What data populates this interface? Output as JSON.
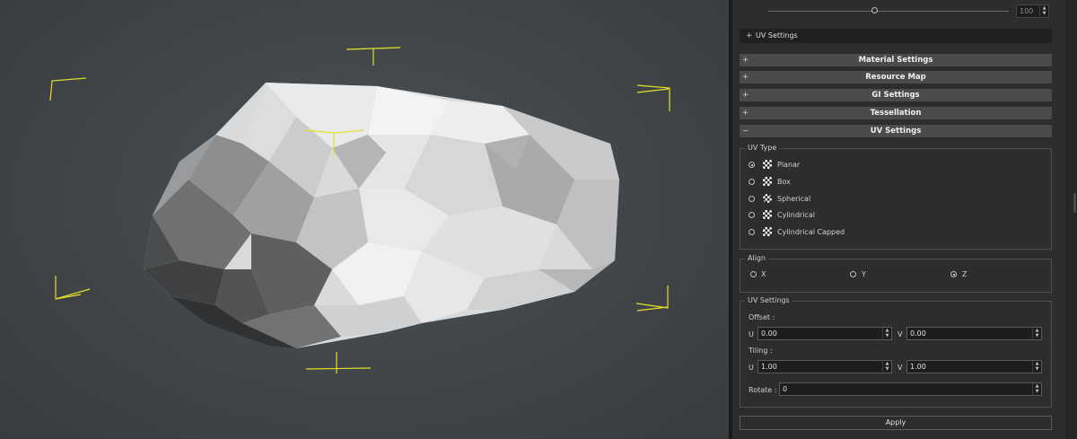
{
  "top_slider": {
    "value": "100"
  },
  "collapsed_header": {
    "sign": "+",
    "label": "UV Settings"
  },
  "sections": [
    {
      "sign": "+",
      "label": "Material Settings"
    },
    {
      "sign": "+",
      "label": "Resource Map"
    },
    {
      "sign": "+",
      "label": "GI Settings"
    },
    {
      "sign": "+",
      "label": "Tessellation"
    },
    {
      "sign": "−",
      "label": "UV Settings"
    }
  ],
  "uv_type": {
    "title": "UV Type",
    "selected": "Planar",
    "options": [
      {
        "label": "Planar"
      },
      {
        "label": "Box"
      },
      {
        "label": "Spherical"
      },
      {
        "label": "Cylindrical"
      },
      {
        "label": "Cylindrical Capped"
      }
    ]
  },
  "align": {
    "title": "Align",
    "selected": "Z",
    "options": [
      {
        "label": "X"
      },
      {
        "label": "Y"
      },
      {
        "label": "Z"
      }
    ]
  },
  "uv_settings": {
    "title": "UV Settings",
    "offset_label": "Offset :",
    "tiling_label": "Tiling :",
    "u_label": "U",
    "v_label": "V",
    "offset_u": "0.00",
    "offset_v": "0.00",
    "tiling_u": "1.00",
    "tiling_v": "1.00",
    "rotate_label": "Rotate :",
    "rotate": "0"
  },
  "apply_label": "Apply",
  "icons": {
    "spinner_up": "triangle-up",
    "spinner_down": "triangle-down",
    "uv_type": "checker-icon"
  },
  "colors": {
    "gizmo": "#e3e02a",
    "panel_bg": "#2c2d2e",
    "section_bar": "#4a4b4c",
    "viewport_bg": "#43474a"
  }
}
